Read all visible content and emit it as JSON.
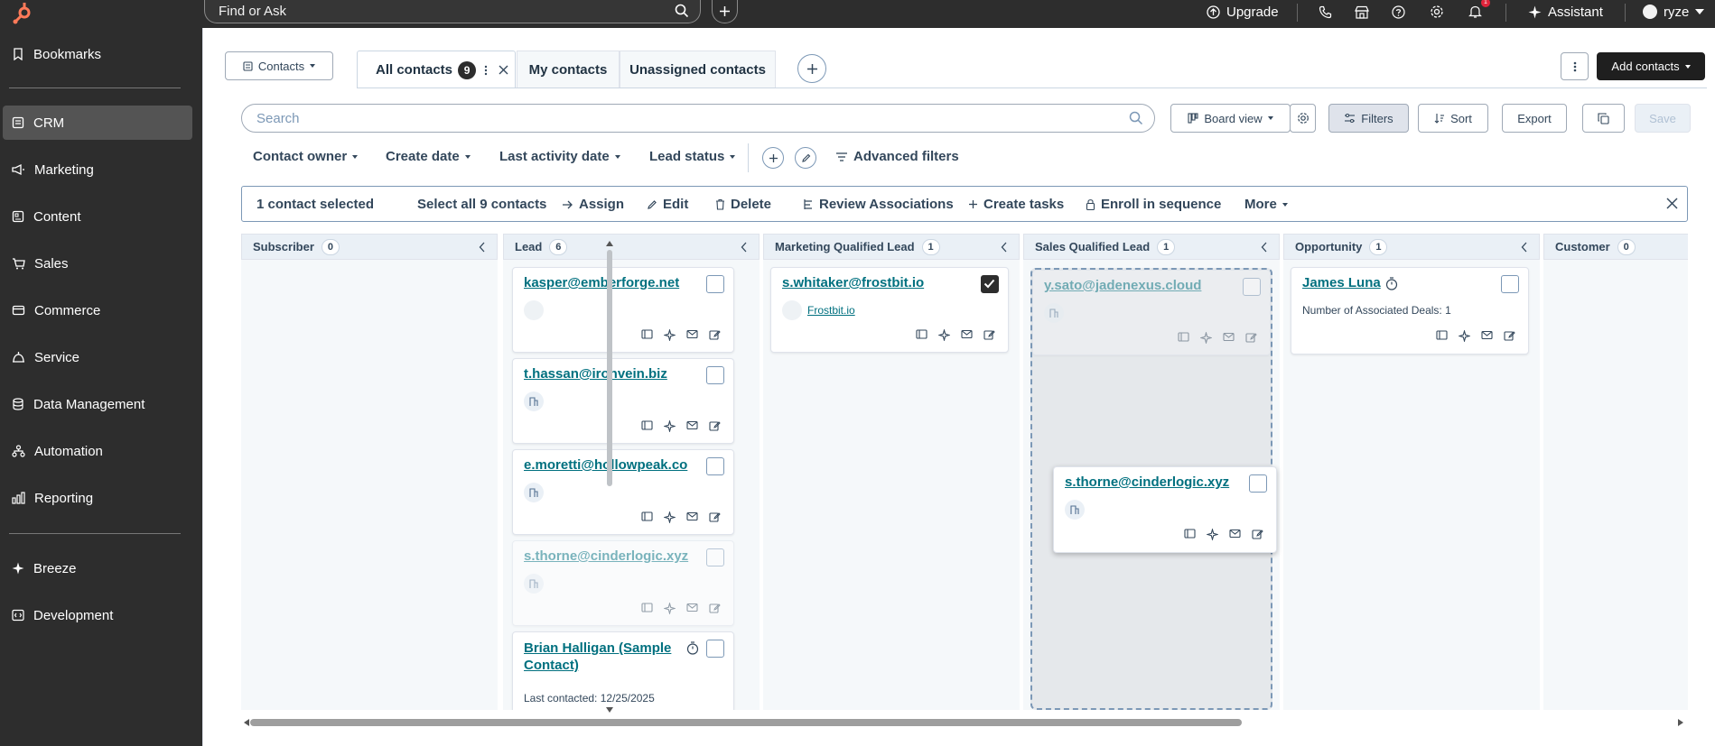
{
  "topbar": {
    "search_placeholder": "Find or Ask",
    "upgrade_label": "Upgrade",
    "assistant_label": "Assistant",
    "user_name": "ryze",
    "notification_count": "1"
  },
  "sidebar": {
    "items": [
      {
        "label": "Bookmarks",
        "icon": "bookmark-icon"
      },
      {
        "label": "CRM",
        "icon": "crm-icon",
        "active": true
      },
      {
        "label": "Marketing",
        "icon": "marketing-icon"
      },
      {
        "label": "Content",
        "icon": "content-icon"
      },
      {
        "label": "Sales",
        "icon": "sales-icon"
      },
      {
        "label": "Commerce",
        "icon": "commerce-icon"
      },
      {
        "label": "Service",
        "icon": "service-icon"
      },
      {
        "label": "Data Management",
        "icon": "database-icon"
      },
      {
        "label": "Automation",
        "icon": "automation-icon"
      },
      {
        "label": "Reporting",
        "icon": "reporting-icon"
      },
      {
        "label": "Breeze",
        "icon": "sparkle-icon"
      },
      {
        "label": "Development",
        "icon": "code-icon"
      }
    ]
  },
  "header": {
    "object_select": "Contacts",
    "tabs": [
      {
        "label": "All contacts",
        "count": "9",
        "active": true
      },
      {
        "label": "My contacts"
      },
      {
        "label": "Unassigned contacts"
      }
    ],
    "add_contacts_label": "Add contacts"
  },
  "toolbar": {
    "search_placeholder": "Search",
    "view_label": "Board view",
    "filters_label": "Filters",
    "sort_label": "Sort",
    "export_label": "Export",
    "save_label": "Save"
  },
  "filters": {
    "contact_owner": "Contact owner",
    "create_date": "Create date",
    "last_activity": "Last activity date",
    "lead_status": "Lead status",
    "advanced": "Advanced filters"
  },
  "bulk": {
    "selected": "1 contact selected",
    "select_all": "Select all 9 contacts",
    "assign": "Assign",
    "edit": "Edit",
    "delete": "Delete",
    "review": "Review Associations",
    "create_tasks": "Create tasks",
    "enroll": "Enroll in sequence",
    "more": "More"
  },
  "board": {
    "columns": [
      {
        "title": "Subscriber",
        "count": "0"
      },
      {
        "title": "Lead",
        "count": "6"
      },
      {
        "title": "Marketing Qualified Lead",
        "count": "1"
      },
      {
        "title": "Sales Qualified Lead",
        "count": "1"
      },
      {
        "title": "Opportunity",
        "count": "1"
      },
      {
        "title": "Customer",
        "count": "0"
      }
    ],
    "lead_cards": [
      {
        "name": "kasper@emberforge.net"
      },
      {
        "name": "t.hassan@ironvein.biz"
      },
      {
        "name": "e.moretti@hollowpeak.co"
      },
      {
        "name": "s.thorne@cinderlogic.xyz"
      },
      {
        "name": "Brian Halligan (Sample",
        "name2": "Contact)",
        "sub": "Last contacted: 12/25/2025"
      }
    ],
    "mql_card": {
      "name": "s.whitaker@frostbit.io",
      "company": "Frostbit.io"
    },
    "sql_card": {
      "name": "y.sato@jadenexus.cloud"
    },
    "dragging_card": {
      "name": "s.thorne@cinderlogic.xyz"
    },
    "opportunity_card": {
      "name": "James Luna",
      "sub": "Number of Associated Deals: 1"
    }
  },
  "colors": {
    "dark": "#2d2d2d",
    "link": "#00707f",
    "text": "#33475b",
    "badge": "#e0243b"
  }
}
